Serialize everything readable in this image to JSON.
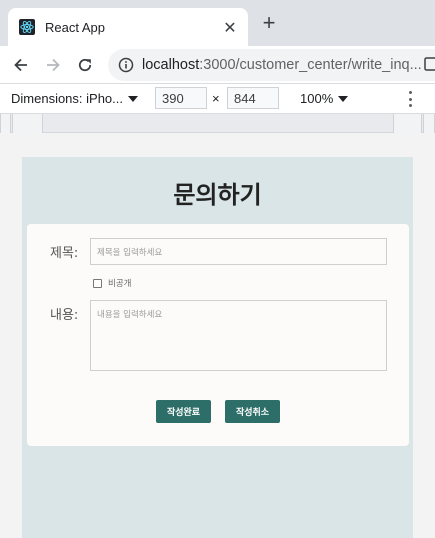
{
  "browser": {
    "tab": {
      "title": "React App",
      "favicon": "react-logo-icon",
      "close_glyph": "✕"
    },
    "new_tab_glyph": "+",
    "address": {
      "host": "localhost",
      "rest": ":3000/customer_center/write_inq..."
    }
  },
  "devtools": {
    "device": "Dimensions: iPho...",
    "width": "390",
    "height": "844",
    "times": "×",
    "zoom": "100%"
  },
  "page": {
    "title": "문의하기",
    "form": {
      "title_label": "제목:",
      "title_placeholder": "제목을 입력하세요",
      "private_label": "비공개",
      "private_checked": false,
      "content_label": "내용:",
      "content_placeholder": "내용을 입력하세요",
      "submit_label": "작성완료",
      "cancel_label": "작성취소"
    }
  },
  "colors": {
    "accent": "#2d6f68",
    "page_bg": "#d9e5e6",
    "card_bg": "#fdfbf9"
  }
}
